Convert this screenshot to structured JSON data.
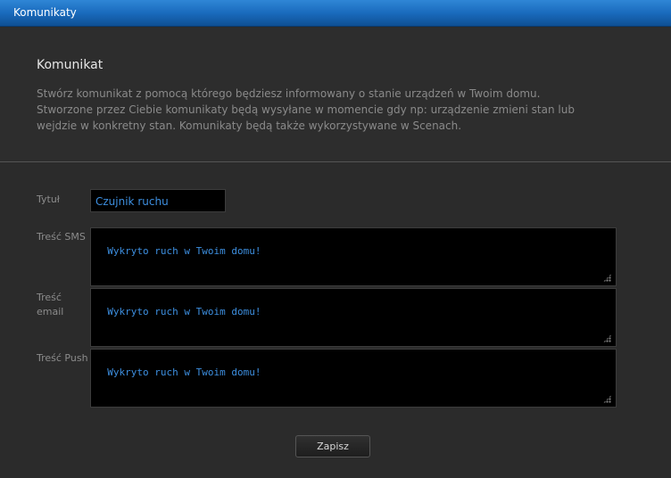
{
  "window": {
    "title": "Komunikaty"
  },
  "header": {
    "title": "Komunikat",
    "description": "Stwórz komunikat z pomocą którego będziesz informowany o stanie urządzeń w Twoim domu. Stworzone przez Ciebie komunikaty będą wysyłane w momencie gdy np: urządzenie zmieni stan lub wejdzie w konkretny stan. Komunikaty będą także wykorzystywane w Scenach."
  },
  "form": {
    "title_label": "Tytuł",
    "title_value": "Czujnik ruchu",
    "sms_label": "Treść SMS",
    "sms_value": "Wykryto ruch w Twoim domu!",
    "email_label": "Treść email",
    "email_value": "Wykryto ruch w Twoim domu!",
    "push_label": "Treść Push",
    "push_value": "Wykryto ruch w Twoim domu!",
    "save_label": "Zapisz"
  },
  "colors": {
    "accent": "#1a6bbd",
    "input_text": "#3d8fe0"
  }
}
